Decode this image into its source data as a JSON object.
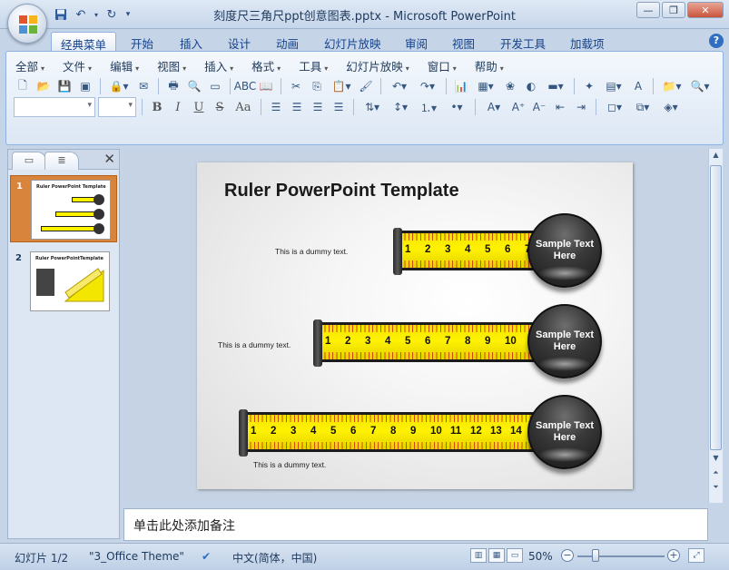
{
  "window": {
    "title": "刻度尺三角尺ppt创意图表.pptx - Microsoft PowerPoint"
  },
  "tabs": [
    {
      "label": "经典菜单",
      "active": true
    },
    {
      "label": "开始"
    },
    {
      "label": "插入"
    },
    {
      "label": "设计"
    },
    {
      "label": "动画"
    },
    {
      "label": "幻灯片放映"
    },
    {
      "label": "审阅"
    },
    {
      "label": "视图"
    },
    {
      "label": "开发工具"
    },
    {
      "label": "加载项"
    }
  ],
  "menu": [
    "全部",
    "文件",
    "编辑",
    "视图",
    "插入",
    "格式",
    "工具",
    "幻灯片放映",
    "窗口",
    "帮助"
  ],
  "formatting": {
    "bold": "B",
    "italic": "I",
    "underline": "U",
    "strike": "S",
    "fontsize": "Aa"
  },
  "panel": {
    "slide1_num": "1",
    "slide2_num": "2",
    "thumb1_title": "Ruler PowerPoint Template",
    "thumb2_title": "Ruler PowerPointTemplate"
  },
  "slide": {
    "title": "Ruler PowerPoint Template",
    "rows": [
      {
        "dummy": "This is a dummy text.",
        "numbers": [
          "1",
          "2",
          "3",
          "4",
          "5",
          "6",
          "7"
        ],
        "badge": [
          "Sample Text",
          "Here"
        ]
      },
      {
        "dummy": "This is a dummy text.",
        "numbers": [
          "1",
          "2",
          "3",
          "4",
          "5",
          "6",
          "7",
          "8",
          "9",
          "10"
        ],
        "badge": [
          "Sample Text",
          "Here"
        ]
      },
      {
        "dummy": "This is a dummy text.",
        "numbers": [
          "1",
          "2",
          "3",
          "4",
          "5",
          "6",
          "7",
          "8",
          "9",
          "10",
          "11",
          "12",
          "13",
          "14"
        ],
        "badge": [
          "Sample Text",
          "Here"
        ]
      }
    ]
  },
  "notes": {
    "placeholder": "单击此处添加备注"
  },
  "status": {
    "slide": "幻灯片 1/2",
    "theme": "\"3_Office Theme\"",
    "language": "中文(简体，中国)",
    "zoom": "50%"
  },
  "colors": {
    "ruler": "#fff200",
    "badge": "#222222",
    "selection": "#d9843c"
  }
}
